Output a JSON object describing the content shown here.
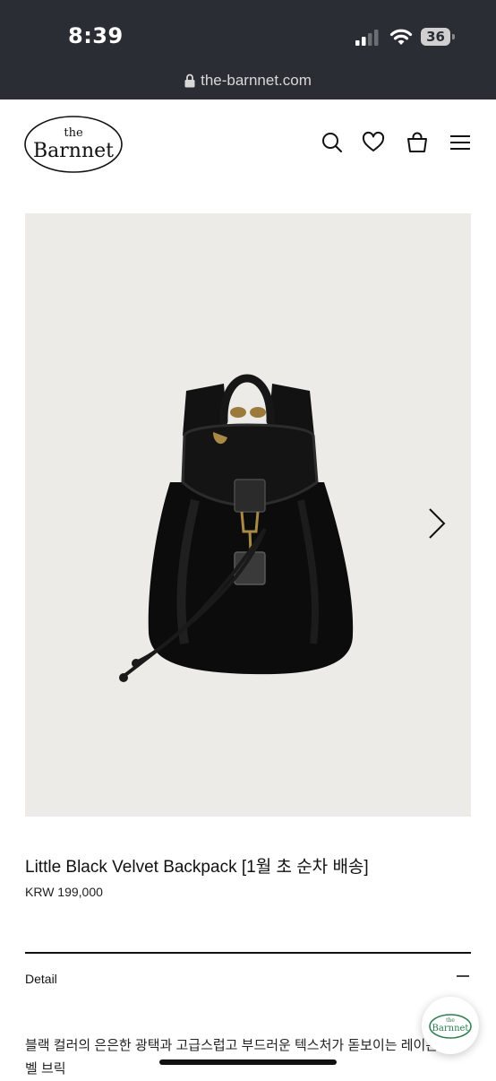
{
  "status_bar": {
    "time": "8:39",
    "battery_level": "36"
  },
  "browser": {
    "url": "the-barnnet.com"
  },
  "header": {
    "logo": {
      "line1": "the",
      "line2": "Barnnet"
    },
    "icons": [
      "search-icon",
      "heart-icon",
      "shopping-bag-icon",
      "menu-icon"
    ]
  },
  "product": {
    "title": "Little Black Velvet Backpack [1월 초 순차 배송]",
    "price": "KRW 199,000",
    "image_alt": "Black velvet backpack with leather trim and gold hardware",
    "detail_label": "Detail",
    "description": "블랙 컬러의 은은한 광택과 고급스럽고 부드러운 텍스처가 돋보이는 레이온 벨 브릭"
  },
  "colors": {
    "status_bar": "#2a2d33",
    "hero_background": "#ecebe7",
    "text": "#111111"
  }
}
